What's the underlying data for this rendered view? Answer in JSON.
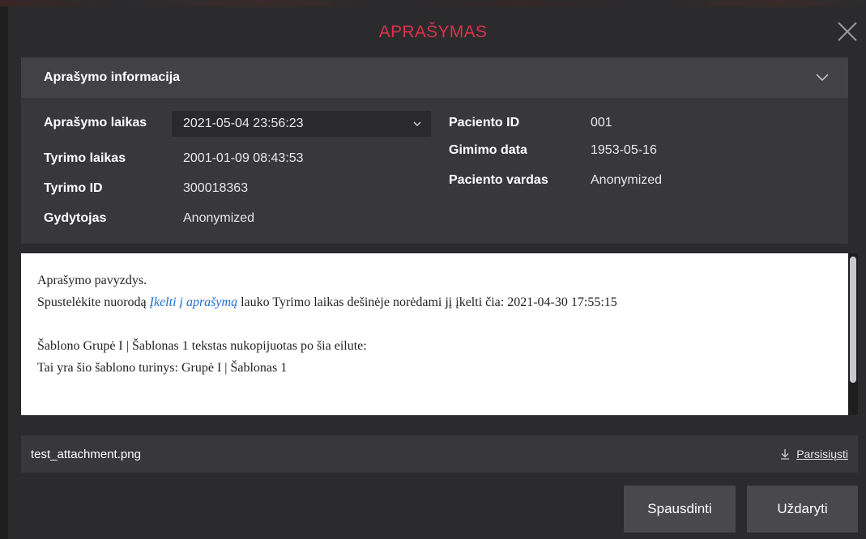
{
  "dialog": {
    "title": "APRAŠYMAS"
  },
  "info": {
    "header": "Aprašymo informacija",
    "left_fields": [
      {
        "label": "Aprašymo laikas",
        "value": "2021-05-04 23:56:23"
      },
      {
        "label": "Tyrimo laikas",
        "value": "2001-01-09 08:43:53"
      },
      {
        "label": "Tyrimo ID",
        "value": "300018363"
      },
      {
        "label": "Gydytojas",
        "value": "Anonymized"
      }
    ],
    "right_fields": [
      {
        "label": "Paciento ID",
        "value": "001"
      },
      {
        "label": "Gimimo data",
        "value": "1953-05-16"
      },
      {
        "label": "Paciento vardas",
        "value": "Anonymized"
      }
    ]
  },
  "editor": {
    "line1": "Aprašymo pavyzdys.",
    "line2_prefix": "Spustelėkite nuorodą ",
    "line2_link": "Įkelti į aprašymą",
    "line2_suffix": " lauko Tyrimo laikas dešinėje norėdami jį įkelti čia: 2021-04-30 17:55:15",
    "line3": "Šablono Grupė I | Šablonas 1 tekstas nukopijuotas po šia eilute:",
    "line4": "Tai yra šio šablono turinys: Grupė I | Šablonas 1"
  },
  "attachment": {
    "filename": "test_attachment.png",
    "download_label": "Parsisiųsti",
    "download_icon": "download-icon"
  },
  "buttons": {
    "print": "Spausdinti",
    "close": "Uždaryti"
  },
  "colors": {
    "title": "#d9324a",
    "link": "#1f6fd0",
    "background": "#2b2b2e",
    "panel": "#38383c"
  }
}
